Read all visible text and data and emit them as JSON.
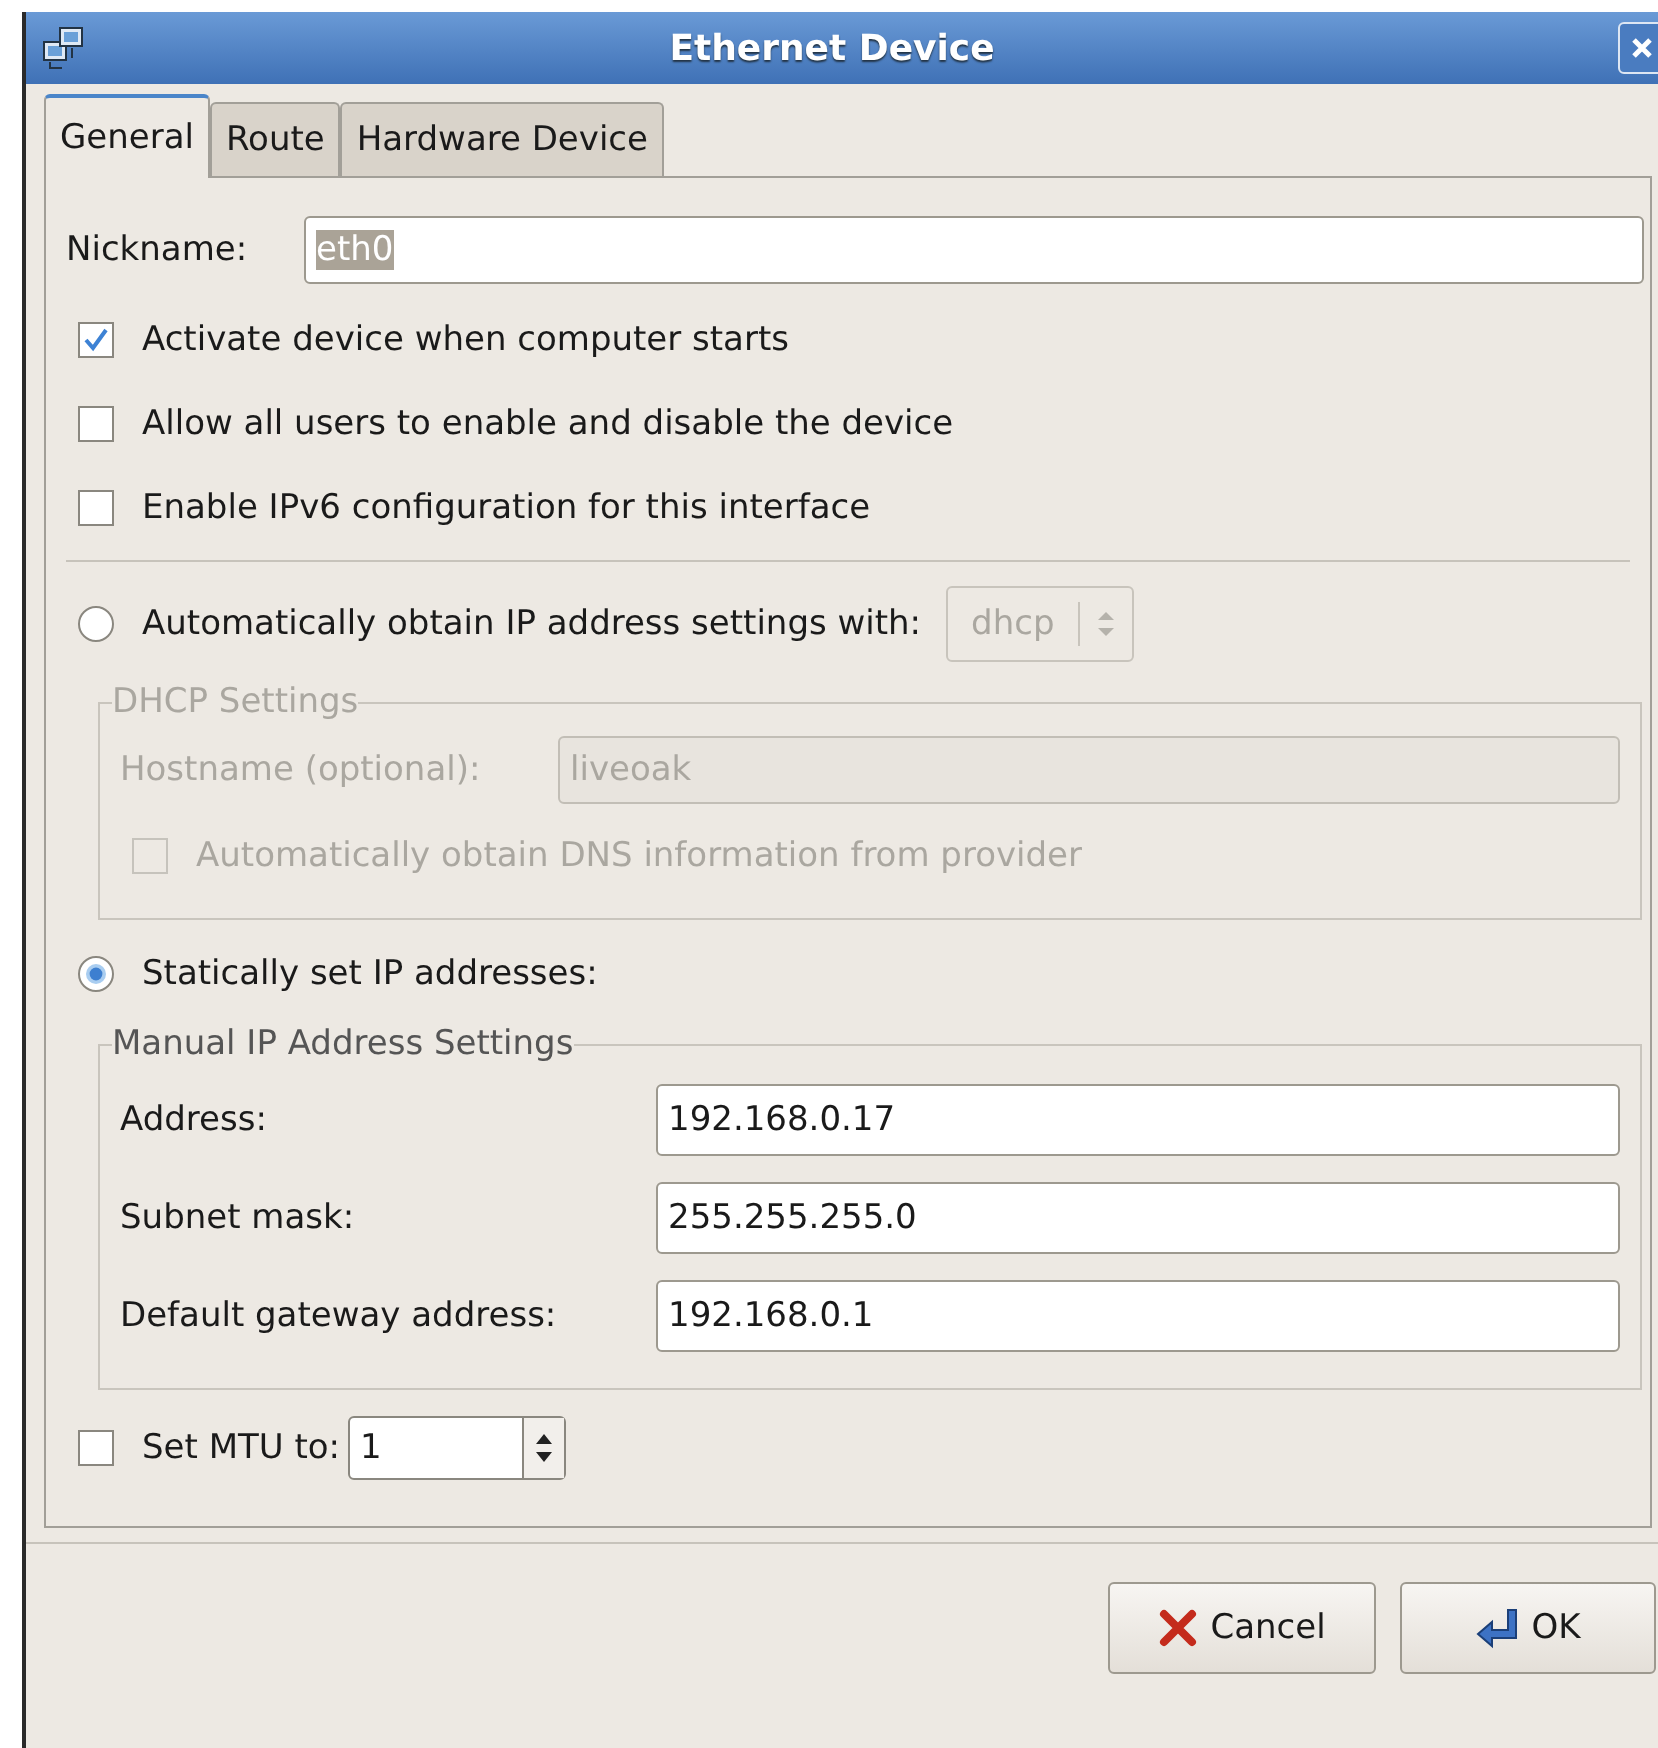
{
  "window": {
    "title": "Ethernet Device"
  },
  "tabs": [
    {
      "label": "General",
      "selected": true
    },
    {
      "label": "Route",
      "selected": false
    },
    {
      "label": "Hardware Device",
      "selected": false
    }
  ],
  "nickname": {
    "label": "Nickname:",
    "value": "eth0",
    "text_selected": true
  },
  "options": [
    {
      "label": "Activate device when computer starts",
      "checked": true
    },
    {
      "label": "Allow all users to enable and disable the device",
      "checked": false
    },
    {
      "label": "Enable IPv6 configuration for this interface",
      "checked": false
    }
  ],
  "auto_ip": {
    "label": "Automatically obtain IP address settings with:",
    "selected": false,
    "method": "dhcp"
  },
  "dhcp_settings": {
    "title": "DHCP Settings",
    "disabled": true,
    "hostname": {
      "label": "Hostname (optional):",
      "value": "liveoak"
    },
    "dns": {
      "label": "Automatically obtain DNS information from provider",
      "checked": false
    }
  },
  "static_ip": {
    "label": "Statically set IP addresses:",
    "selected": true
  },
  "manual_settings": {
    "title": "Manual IP Address Settings",
    "fields": [
      {
        "label": "Address:",
        "value": "192.168.0.17"
      },
      {
        "label": "Subnet mask:",
        "value": "255.255.255.0"
      },
      {
        "label": "Default gateway address:",
        "value": "192.168.0.1"
      }
    ]
  },
  "mtu": {
    "label": "Set MTU to:",
    "checked": false,
    "value": "1"
  },
  "buttons": [
    {
      "label": "Cancel",
      "kind": "cancel"
    },
    {
      "label": "OK",
      "kind": "ok"
    }
  ]
}
